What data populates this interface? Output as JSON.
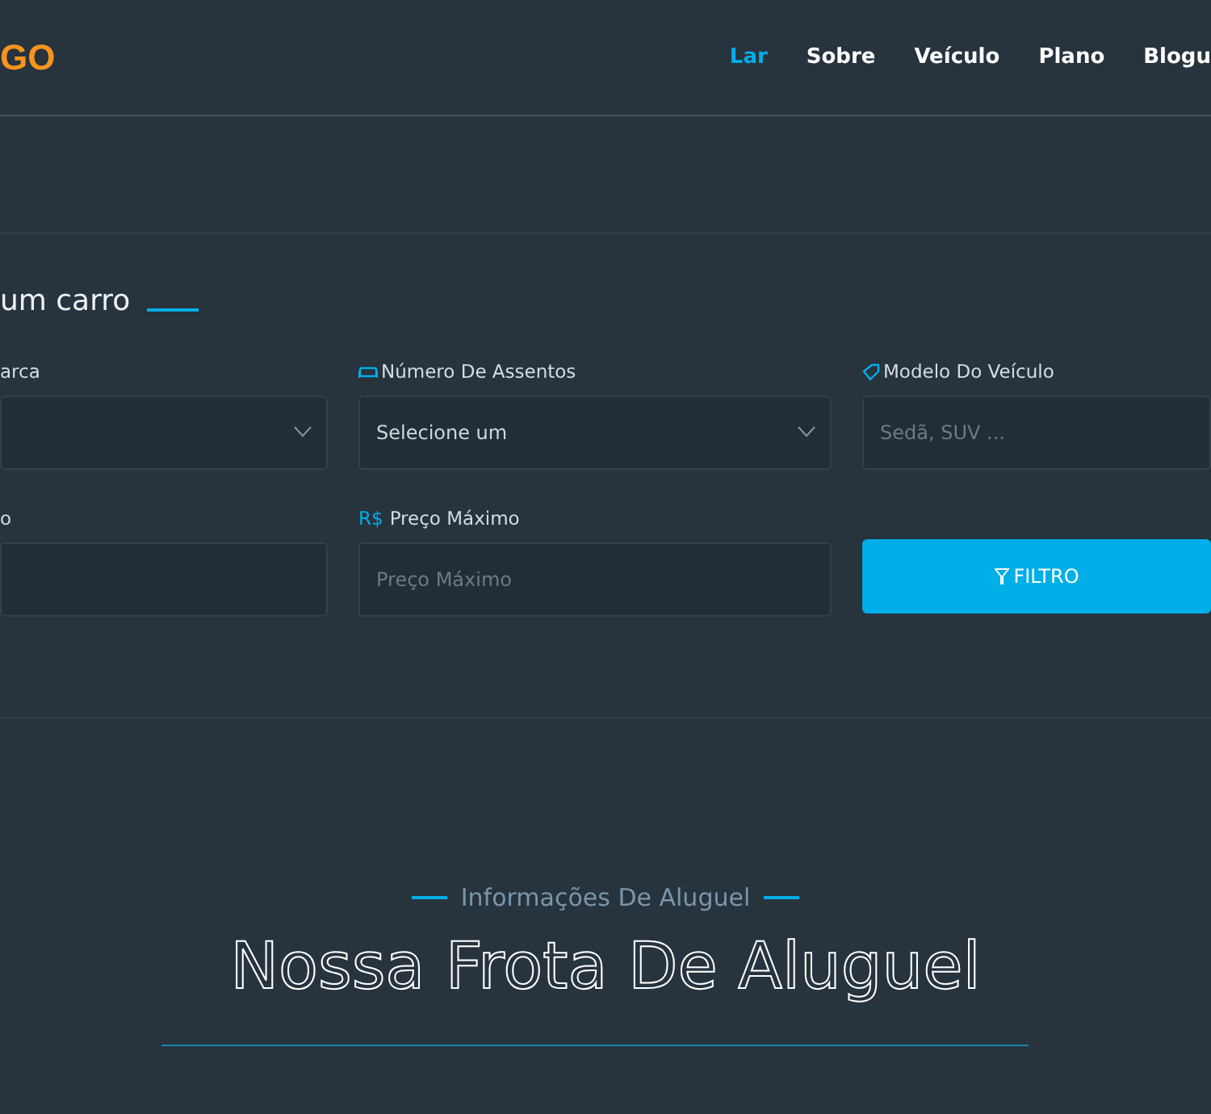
{
  "logo": "GO",
  "nav": [
    {
      "label": "Lar",
      "selected": true
    },
    {
      "label": "Sobre",
      "selected": false
    },
    {
      "label": "Veículo",
      "selected": false
    },
    {
      "label": "Plano",
      "selected": false
    },
    {
      "label": "Blogu",
      "selected": false
    }
  ],
  "search": {
    "title": "um carro",
    "fields": [
      {
        "kind": "select",
        "label": "arca"
      },
      {
        "kind": "select",
        "label": "Número De Assentos",
        "value": "Selecione um"
      },
      {
        "kind": "input",
        "label": "Modelo Do Veículo",
        "placeholder": "Sedã, SUV ..."
      },
      {
        "kind": "input",
        "label": "o"
      },
      {
        "kind": "input",
        "prefix": "R$",
        "label": "Preço Máximo",
        "placeholder": "Preço Máximo"
      },
      {
        "kind": "button",
        "label": "FILTRO"
      }
    ]
  },
  "fleet": {
    "subtitle": "Informações De Aluguel",
    "title": "Nossa Frota De Aluguel"
  }
}
